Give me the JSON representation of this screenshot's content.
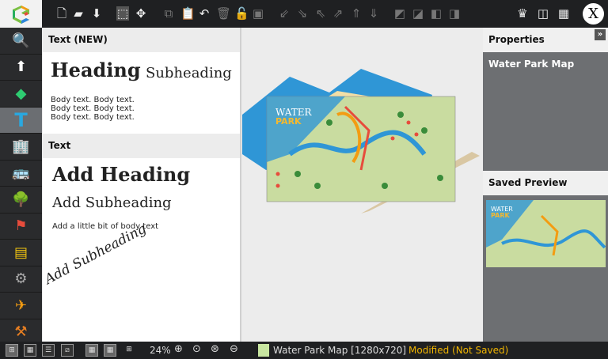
{
  "toolbar": {
    "close_label": "X"
  },
  "panel": {
    "section1_title": "Text (NEW)",
    "heading": "Heading",
    "subheading": "Subheading",
    "body1": "Body text. Body text.",
    "body2": "Body text. Body text.",
    "body3": "Body text. Body text.",
    "section2_title": "Text",
    "add_heading": "Add Heading",
    "add_subheading": "Add Subheading",
    "add_body": "Add a little bit of body text",
    "curved_subheading": "Add Subheading"
  },
  "properties": {
    "title": "Properties",
    "item_name": "Water Park Map",
    "saved_preview": "Saved Preview"
  },
  "map": {
    "title_line1": "WATER",
    "title_line2": "PARK"
  },
  "status": {
    "zoom": "24%",
    "document": "Water Park Map [1280x720]",
    "state": "Modified (Not Saved)",
    "swatch_color": "#c8e6a0",
    "state_color": "#f0b400"
  }
}
